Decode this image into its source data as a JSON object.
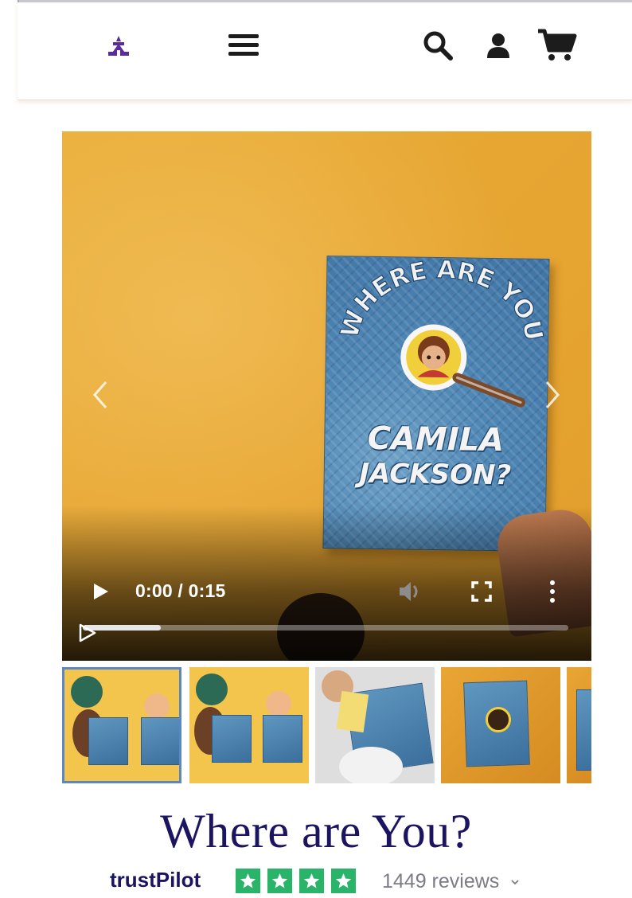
{
  "header": {
    "logo_icon": "castle-logo-icon",
    "menu_icon": "hamburger-menu-icon",
    "search_icon": "search-icon",
    "account_icon": "user-icon",
    "cart_icon": "shopping-cart-icon",
    "icon_color": "#1c1c1c",
    "logo_color": "#5a2aa0"
  },
  "media": {
    "book_line1": "WHERE ARE YOU",
    "book_name_first": "CAMILA",
    "book_name_last": "JACKSON?",
    "prev_icon": "chevron-left-icon",
    "next_icon": "chevron-right-icon"
  },
  "video": {
    "time": "0:00 / 0:15",
    "play_icon": "play-icon",
    "volume_icon": "volume-icon",
    "fullscreen_icon": "fullscreen-icon",
    "more_icon": "more-vertical-icon",
    "buffered_fraction": 0.16,
    "played_fraction": 0
  },
  "thumbnails": [
    {
      "label": "",
      "active": true
    },
    {
      "label": "",
      "active": false
    },
    {
      "label": "",
      "active": false
    },
    {
      "label": "",
      "active": false
    },
    {
      "label": "",
      "active": false
    }
  ],
  "product": {
    "title": "Where are You?",
    "title_color": "#1a1461"
  },
  "trustpilot": {
    "brand": "trustPilot",
    "stars": 4,
    "star_color": "#29b46a",
    "reviews_text": "1449 reviews",
    "dropdown_icon": "chevron-down-icon"
  }
}
